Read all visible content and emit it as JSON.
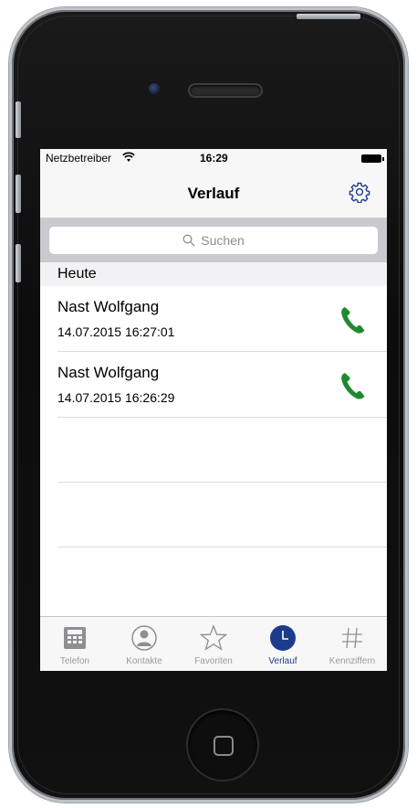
{
  "status_bar": {
    "carrier": "Netzbetreiber",
    "time": "16:29",
    "wifi_icon": "wifi-icon",
    "battery_icon": "battery-icon"
  },
  "nav_bar": {
    "title": "Verlauf",
    "settings_icon": "gear-icon"
  },
  "search": {
    "placeholder": "Suchen"
  },
  "section": {
    "title": "Heute"
  },
  "calls": [
    {
      "name": "Nast Wolfgang",
      "timestamp": "14.07.2015 16:27:01",
      "icon": "phone-icon"
    },
    {
      "name": "Nast Wolfgang",
      "timestamp": "14.07.2015 16:26:29",
      "icon": "phone-icon"
    }
  ],
  "tabs": [
    {
      "label": "Telefon",
      "icon": "keypad-icon",
      "active": false
    },
    {
      "label": "Kontakte",
      "icon": "contact-icon",
      "active": false
    },
    {
      "label": "Favoriten",
      "icon": "star-icon",
      "active": false
    },
    {
      "label": "Verlauf",
      "icon": "clock-icon",
      "active": true
    },
    {
      "label": "Kennziffern",
      "icon": "hash-icon",
      "active": false
    }
  ],
  "colors": {
    "accent": "#1c3b8a",
    "call_green": "#1e8a2e",
    "tab_inactive": "#9b9b9b"
  }
}
